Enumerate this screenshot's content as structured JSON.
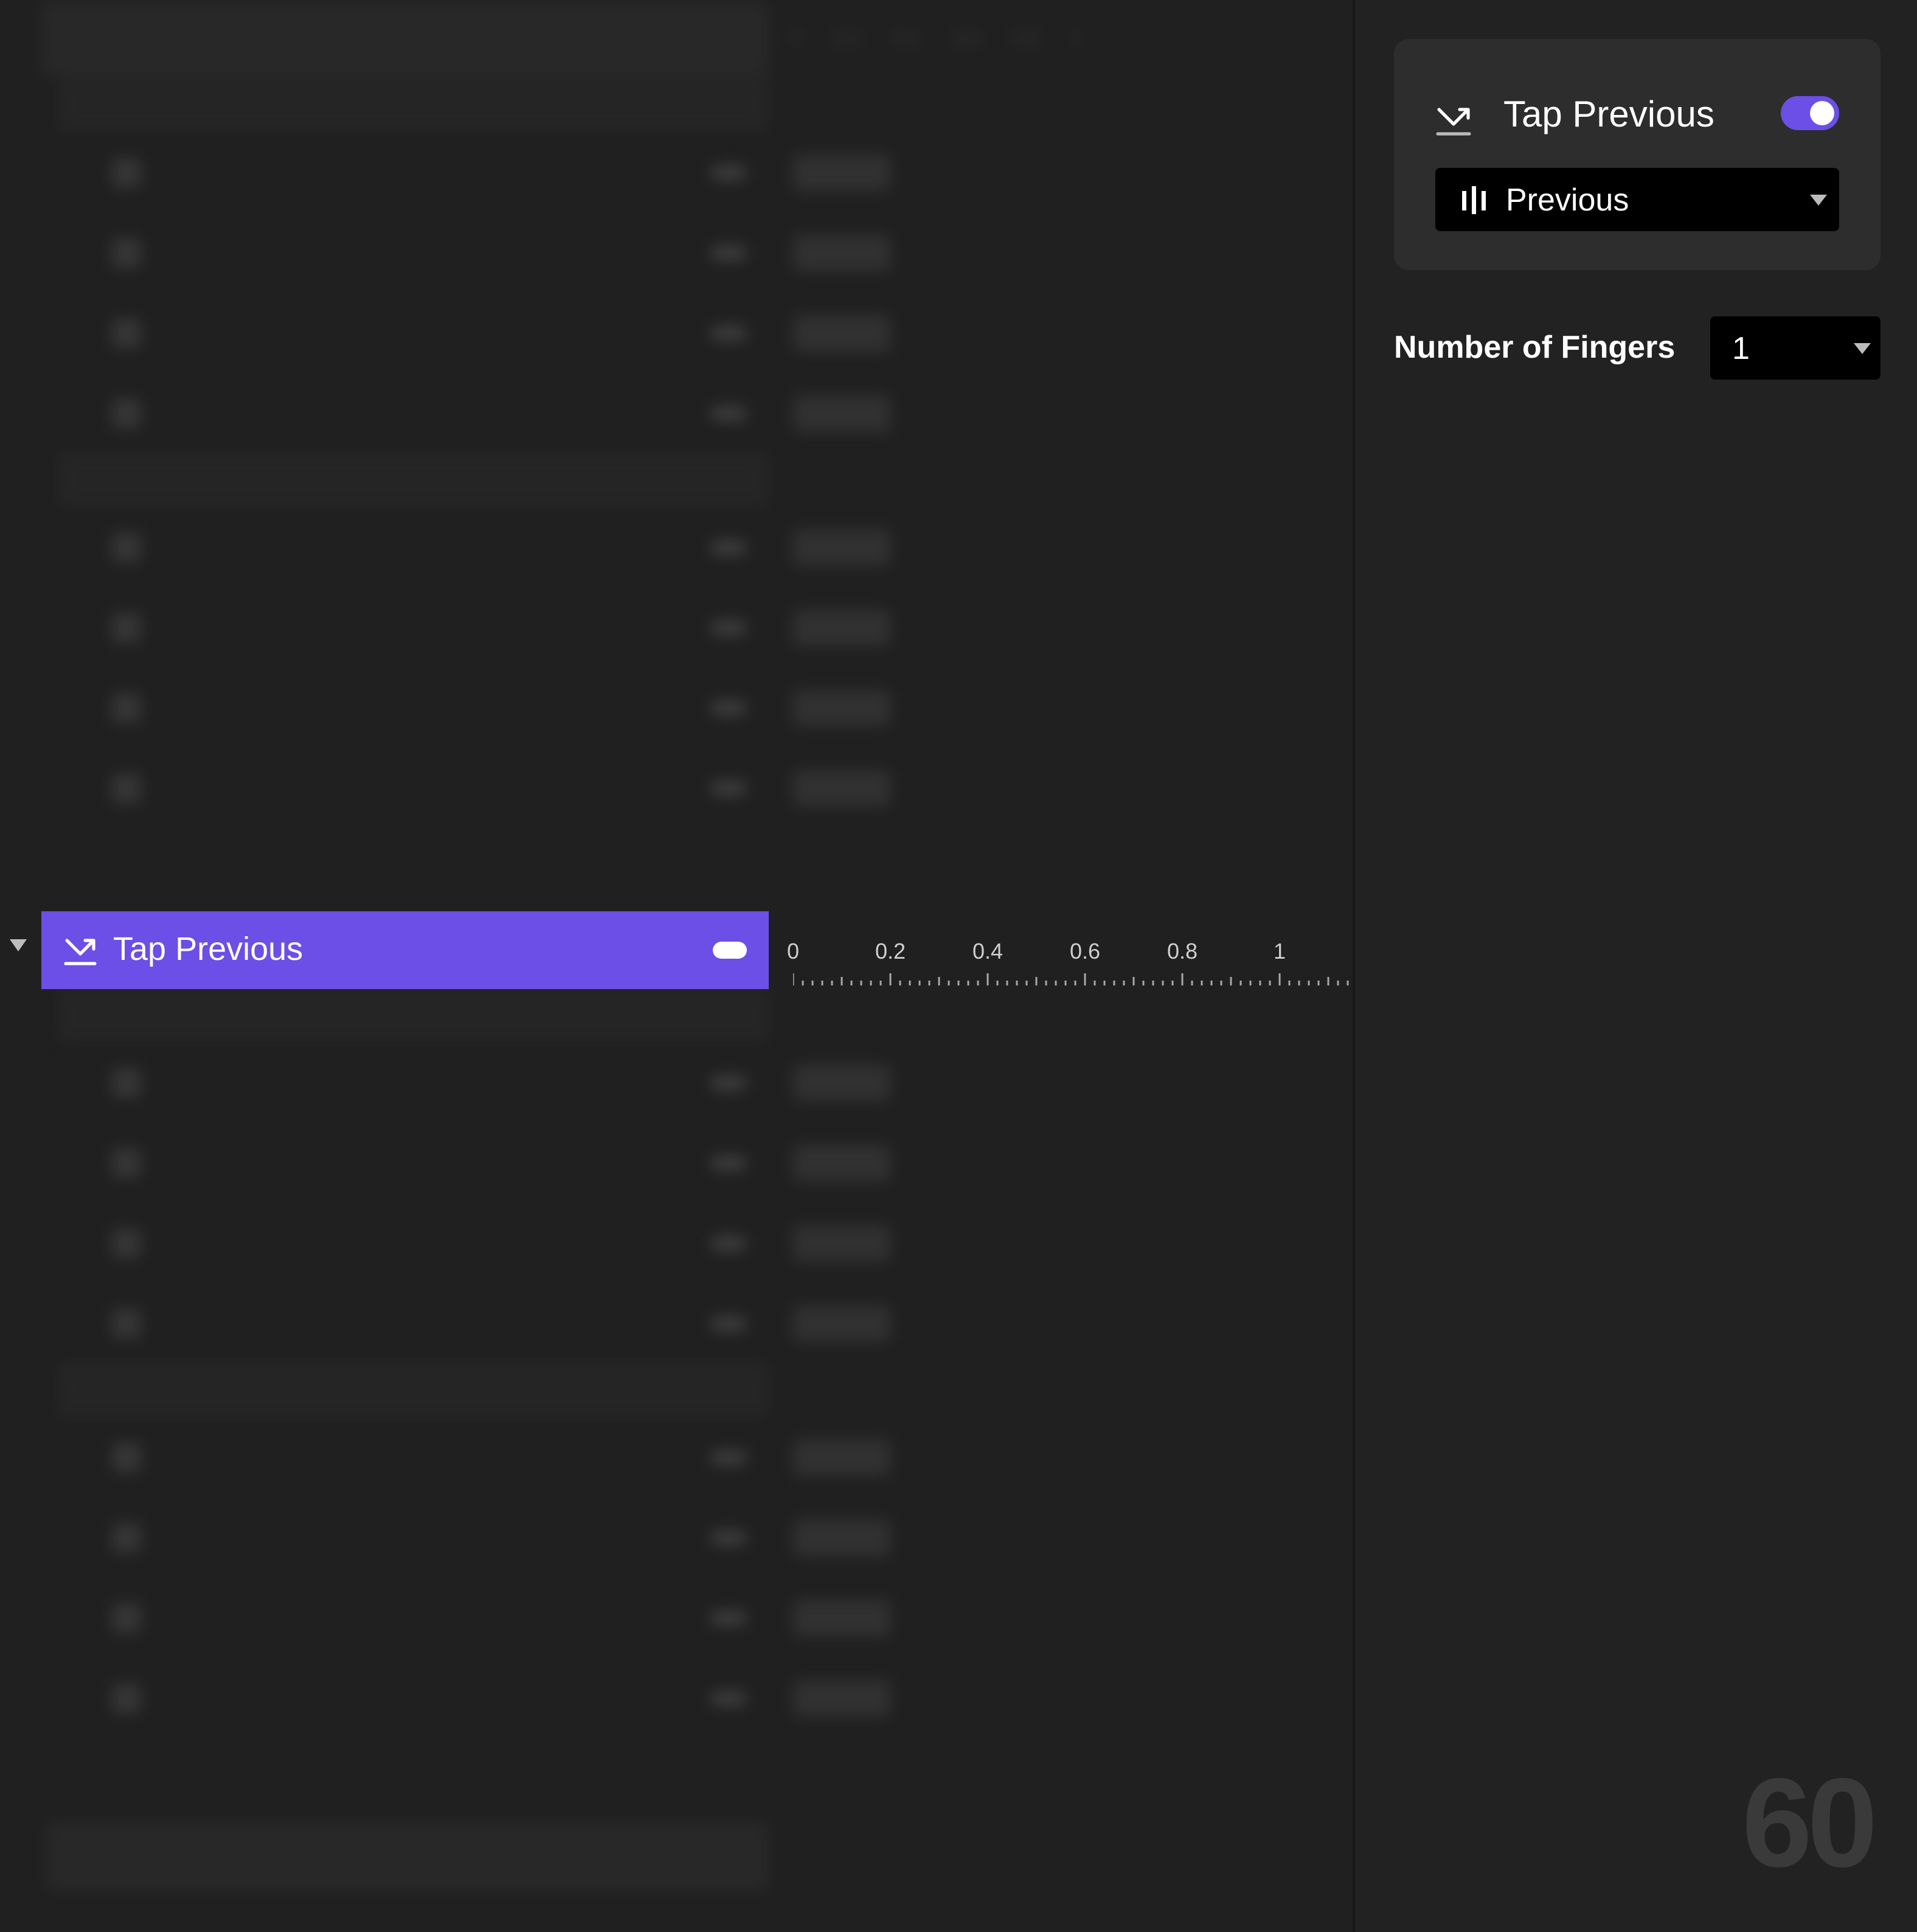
{
  "timeline": {
    "ticks": [
      "0",
      "0.2",
      "0.4",
      "0.6",
      "0.8",
      "1"
    ]
  },
  "selected_trigger": {
    "label": "Tap Previous",
    "icon": "swipe-down-icon",
    "accent": "#6b4fe6"
  },
  "inspector": {
    "title": "Tap Previous",
    "toggle_on": true,
    "action_icon": "bars-icon",
    "action_value": "Previous",
    "fingers_label": "Number of Fingers",
    "fingers_value": "1"
  },
  "fps_counter": "60"
}
